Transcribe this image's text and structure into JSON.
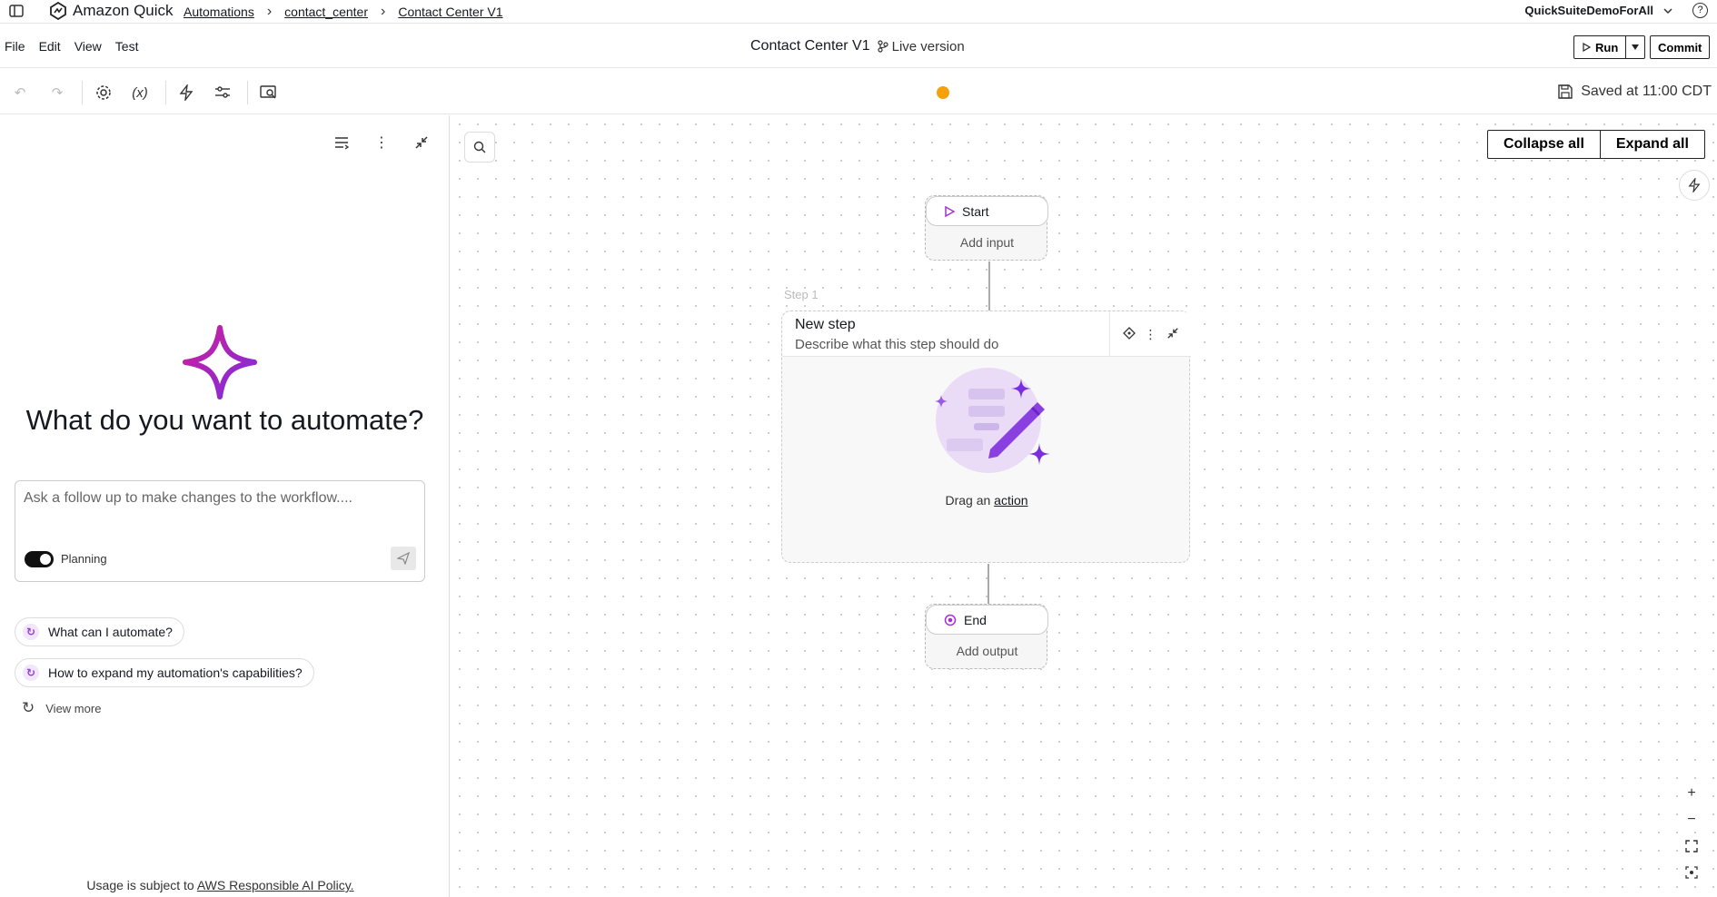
{
  "app": {
    "brand": "Amazon Quick",
    "breadcrumbs": [
      "Automations",
      "contact_center",
      "Contact Center V1"
    ],
    "account": "QuickSuiteDemoForAll"
  },
  "menubar": {
    "menus": [
      "File",
      "Edit",
      "View",
      "Test"
    ],
    "title": "Contact Center V1",
    "version": "Live version",
    "run_label": "Run",
    "commit_label": "Commit"
  },
  "toolbar": {
    "saved_text": "Saved at 11:00 CDT",
    "status_color": "#f5a10a"
  },
  "assistant": {
    "headline": "What do you want to automate?",
    "input_placeholder": "Ask a follow up to make changes to the workflow....",
    "planning_label": "Planning",
    "planning_on": true,
    "suggestions": [
      "What can I automate?",
      "How to expand my automation's capabilities?"
    ],
    "view_more": "View more",
    "usage_prefix": "Usage is subject to ",
    "usage_link": "AWS Responsible AI Policy."
  },
  "canvas": {
    "collapse_all": "Collapse all",
    "expand_all": "Expand all",
    "start": {
      "label": "Start",
      "sub": "Add input"
    },
    "step": {
      "number_label": "Step 1",
      "title": "New step",
      "description": "Describe what this step should do",
      "drag_prefix": "Drag an ",
      "drag_link": "action"
    },
    "end": {
      "label": "End",
      "sub": "Add output"
    },
    "accent": "#a52fd6"
  }
}
